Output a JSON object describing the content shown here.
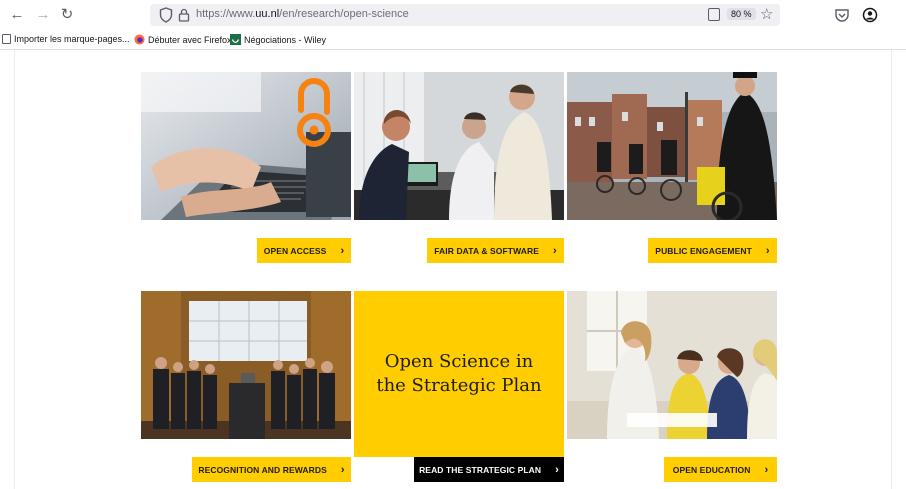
{
  "browser": {
    "url_prefix": "https://www.",
    "url_domain": "uu.nl",
    "url_path": "/en/research/open-science",
    "zoom": "80 %"
  },
  "bookmarks": [
    {
      "label": "Importer les marque-pages..."
    },
    {
      "label": "Débuter avec Firefox"
    },
    {
      "label": "Négociations - Wiley"
    }
  ],
  "tiles": {
    "open_access": {
      "label": "OPEN ACCESS"
    },
    "fair_data": {
      "label": "FAIR DATA & SOFTWARE"
    },
    "public_engagement": {
      "label": "PUBLIC ENGAGEMENT"
    },
    "recognition": {
      "label": "RECOGNITION AND REWARDS"
    },
    "strategic_plan": {
      "title": "Open Science in the Strategic Plan",
      "label": "READ THE STRATEGIC PLAN"
    },
    "open_education": {
      "label": "OPEN EDUCATION"
    }
  },
  "colors": {
    "brand_yellow": "#ffcd00",
    "dark_button": "#000000",
    "open_access_orange": "#f68212"
  }
}
